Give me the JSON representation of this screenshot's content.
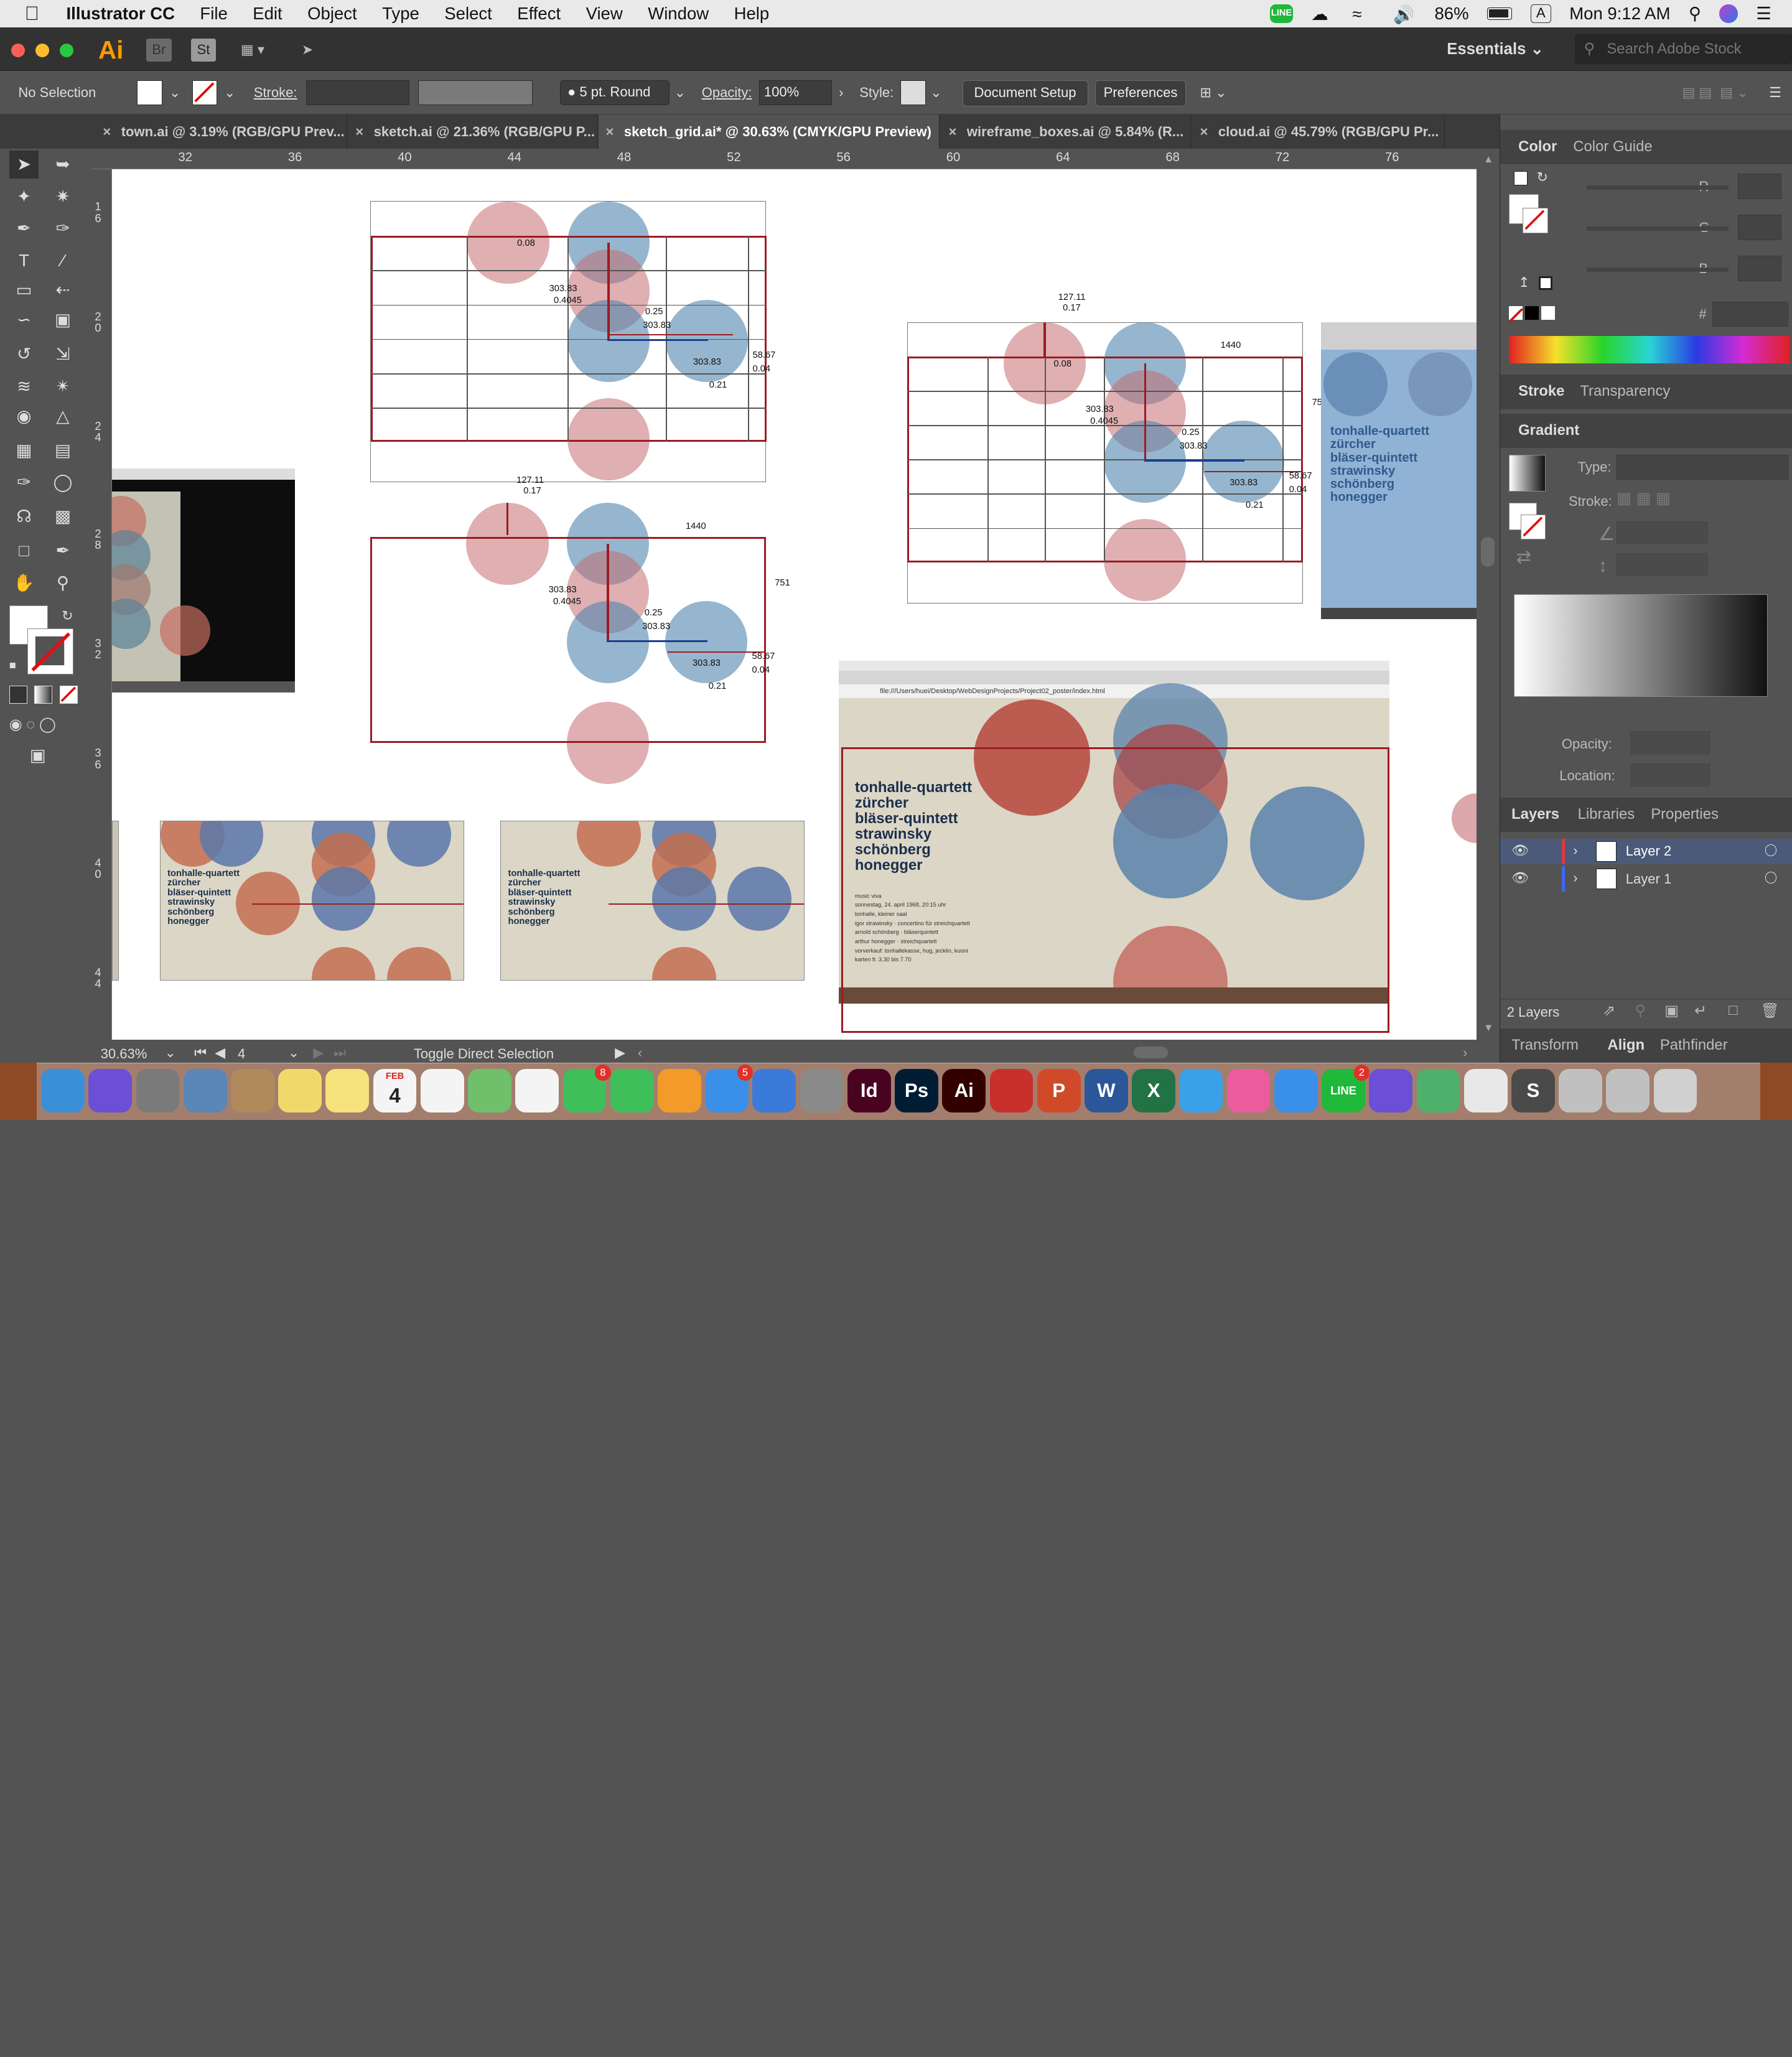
{
  "menubar": {
    "items": [
      "Illustrator CC",
      "File",
      "Edit",
      "Object",
      "Type",
      "Select",
      "Effect",
      "View",
      "Window",
      "Help"
    ],
    "battery": "86%",
    "input_source": "A",
    "clock": "Mon 9:12 AM"
  },
  "appbar": {
    "logo": "Ai",
    "bridge": "Br",
    "stock_btn": "St",
    "workspace": "Essentials",
    "search_placeholder": "Search Adobe Stock"
  },
  "control": {
    "selection": "No Selection",
    "stroke_label": "Stroke:",
    "brush": "5 pt. Round",
    "opacity_label": "Opacity:",
    "opacity_value": "100%",
    "style_label": "Style:",
    "document_setup": "Document Setup",
    "preferences": "Preferences"
  },
  "tabs": [
    {
      "label": "town.ai @ 3.19% (RGB/GPU Prev..."
    },
    {
      "label": "sketch.ai @ 21.36% (RGB/GPU P..."
    },
    {
      "label": "sketch_grid.ai* @ 30.63% (CMYK/GPU Preview)"
    },
    {
      "label": "wireframe_boxes.ai @ 5.84% (R..."
    },
    {
      "label": "cloud.ai @ 45.79% (RGB/GPU Pr..."
    }
  ],
  "ruler": {
    "h": [
      "32",
      "36",
      "40",
      "44",
      "48",
      "52",
      "56",
      "60",
      "64",
      "68",
      "72",
      "76"
    ],
    "v": [
      "1 6",
      "2 0",
      "2 4",
      "2 8",
      "3 2",
      "3 6",
      "4 0",
      "4 4"
    ]
  },
  "canvas": {
    "labels_a": [
      "0.08",
      "303.83",
      "0.4045",
      "0.25",
      "303.83",
      "58.67",
      "303.83",
      "0.04",
      "0.21"
    ],
    "labels_b": [
      "127.11",
      "0.17",
      "1440",
      "751",
      "303.83",
      "0.4045",
      "0.25",
      "303.83",
      "58.67",
      "303.83",
      "0.04",
      "0.21"
    ],
    "labels_c": [
      "127.11",
      "0.17",
      "1440",
      "75",
      "0.08",
      "303.83",
      "0.4045",
      "0.25",
      "303.83",
      "58.67",
      "303.83",
      "0.04",
      "0.21"
    ],
    "poster_lines": [
      "tonhalle-quartett",
      "zürcher",
      "bläser-quintett",
      "strawinsky",
      "schönberg",
      "honegger"
    ],
    "poster_small": [
      "music viva",
      "sonnestag, 24. april 1968, 20:15 uhr",
      "tonhalle, kleiner saal",
      "igor strawinsky · concertino für streichquartett",
      "arnold schönberg · bläserquintett",
      "arthur honegger · streichquartett",
      "vorverkauf: tonhallekasse, hug, jecklin, kuoni",
      "karten fr. 3.30 bis 7.70"
    ],
    "browser_url": "file:///Users/huei/Desktop/WebDesignProjects/Project02_poster/index.html"
  },
  "status": {
    "zoom": "30.63%",
    "artboard": "4",
    "hint": "Toggle Direct Selection"
  },
  "panels": {
    "color_tabs": [
      "Color",
      "Color Guide"
    ],
    "rgb": [
      "R",
      "G",
      "B"
    ],
    "hash": "#",
    "stroke_tabs": [
      "Stroke",
      "Transparency"
    ],
    "gradient": "Gradient",
    "type_label": "Type:",
    "stroke_label": "Stroke:",
    "opacity_label": "Opacity:",
    "location_label": "Location:",
    "layer_tabs": [
      "Layers",
      "Libraries",
      "Properties"
    ],
    "layers": [
      {
        "name": "Layer 2",
        "color": "#e0383e"
      },
      {
        "name": "Layer 1",
        "color": "#3d6af5"
      }
    ],
    "layer_count": "2 Layers",
    "bottom_tabs": [
      "Transform",
      "Align",
      "Pathfinder"
    ]
  },
  "dock": {
    "calendar_month": "FEB",
    "calendar_day": "4",
    "apps": [
      {
        "name": "finder",
        "label": "",
        "color": "#3a8fd9"
      },
      {
        "name": "siri",
        "label": "",
        "color": "#6b4fd6"
      },
      {
        "name": "launchpad",
        "label": "",
        "color": "#7a7a7a"
      },
      {
        "name": "preview",
        "label": "",
        "color": "#5a87b5"
      },
      {
        "name": "contacts",
        "label": "",
        "color": "#b08a5a"
      },
      {
        "name": "stickies",
        "label": "",
        "color": "#f1d86b"
      },
      {
        "name": "notes",
        "label": "",
        "color": "#f5e27a"
      },
      {
        "name": "calendar",
        "label": "",
        "color": "#f4f4f4"
      },
      {
        "name": "reminders",
        "label": "",
        "color": "#f4f4f4"
      },
      {
        "name": "maps",
        "label": "",
        "color": "#6fbf6b"
      },
      {
        "name": "photos",
        "label": "",
        "color": "#f4f4f4"
      },
      {
        "name": "messages",
        "label": "",
        "color": "#3fbf5a"
      },
      {
        "name": "facetime",
        "label": "",
        "color": "#3fbf5a"
      },
      {
        "name": "books",
        "label": "",
        "color": "#f39a2b"
      },
      {
        "name": "app-store",
        "label": "",
        "color": "#3a8fe9"
      },
      {
        "name": "keynote",
        "label": "",
        "color": "#3a7ad9"
      },
      {
        "name": "system-preferences",
        "label": "",
        "color": "#8a8a8a"
      },
      {
        "name": "indesign",
        "label": "Id",
        "color": "#49021f"
      },
      {
        "name": "photoshop",
        "label": "Ps",
        "color": "#001d34"
      },
      {
        "name": "illustrator",
        "label": "Ai",
        "color": "#330000"
      },
      {
        "name": "acrobat",
        "label": "",
        "color": "#c9302c"
      },
      {
        "name": "powerpoint",
        "label": "P",
        "color": "#d04a2a"
      },
      {
        "name": "word",
        "label": "W",
        "color": "#2b579a"
      },
      {
        "name": "excel",
        "label": "X",
        "color": "#217346"
      },
      {
        "name": "safari-alt",
        "label": "",
        "color": "#3aa1e9"
      },
      {
        "name": "itunes",
        "label": "",
        "color": "#ec5b9b"
      },
      {
        "name": "safari",
        "label": "",
        "color": "#3a8fe9"
      },
      {
        "name": "line",
        "label": "LINE",
        "color": "#1fb83a"
      },
      {
        "name": "github",
        "label": "",
        "color": "#6b4fd6"
      },
      {
        "name": "atom",
        "label": "",
        "color": "#4fb06b"
      },
      {
        "name": "chrome",
        "label": "",
        "color": "#e8e8e8"
      },
      {
        "name": "sublime",
        "label": "S",
        "color": "#4a4a4a"
      },
      {
        "name": "documents",
        "label": "",
        "color": "#c0c0c0"
      },
      {
        "name": "downloads",
        "label": "",
        "color": "#c0c0c0"
      },
      {
        "name": "trash",
        "label": "",
        "color": "#d0d0d0"
      }
    ],
    "badges": {
      "messages": "8",
      "app-store": "5",
      "line": "2"
    }
  }
}
